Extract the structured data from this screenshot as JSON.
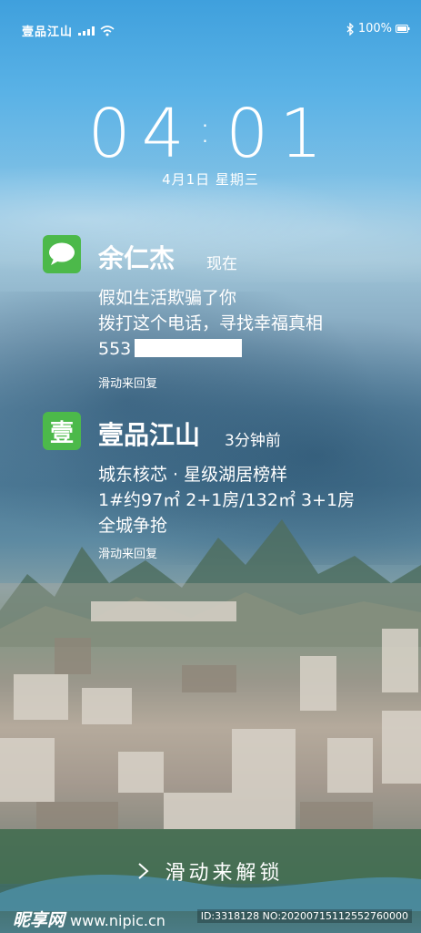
{
  "status_bar": {
    "carrier": "壹品江山",
    "battery": "100%",
    "icons": [
      "signal-icon",
      "wifi-icon",
      "bluetooth-icon"
    ]
  },
  "lock": {
    "hour": "04",
    "minute": "01",
    "date": "4月1日 星期三",
    "unlock_label": "滑动来解锁"
  },
  "notifications": [
    {
      "icon": "message-icon",
      "title": "余仁杰",
      "time": "现在",
      "lines": [
        "假如生活欺骗了你",
        "拨打这个电话，寻找幸福真相",
        "553"
      ],
      "hint": "滑动来回复"
    },
    {
      "icon": "app-logo-icon",
      "icon_char": "壹",
      "title": "壹品江山",
      "time": "3分钟前",
      "lines": [
        "城东核芯 · 星级湖居榜样",
        "1#约97㎡ 2+1房/132㎡ 3+1房",
        "全城争抢"
      ],
      "hint": "滑动来回复"
    }
  ],
  "watermark": {
    "brand": "昵享网",
    "url": "www.nipic.cn",
    "id": "ID:3318128 NO:20200715112552760000"
  },
  "colors": {
    "app_green": "#4cb94a"
  }
}
